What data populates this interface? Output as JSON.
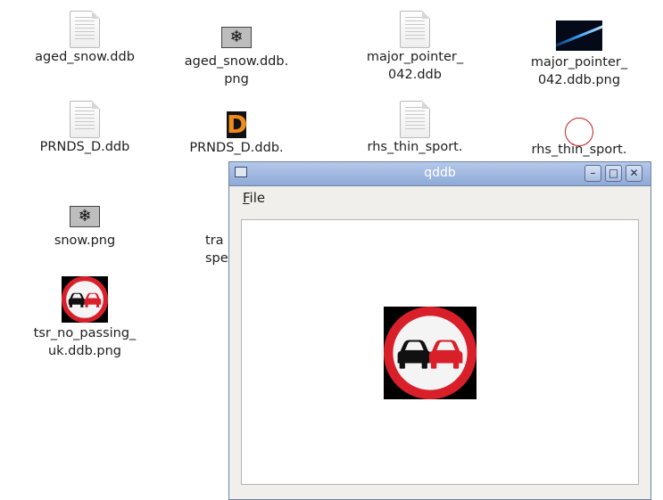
{
  "desktop": {
    "icons": [
      {
        "label": "aged_snow.ddb",
        "type": "document"
      },
      {
        "label": "aged_snow.ddb.\npng",
        "type": "snow-image"
      },
      {
        "label": "major_pointer_\n042.ddb",
        "type": "document"
      },
      {
        "label": "major_pointer_\n042.ddb.png",
        "type": "pointer-image"
      },
      {
        "label": "PRNDS_D.ddb",
        "type": "document"
      },
      {
        "label": "PRNDS_D.ddb.",
        "type": "d-image"
      },
      {
        "label": "rhs_thin_sport.",
        "type": "document"
      },
      {
        "label": "rhs_thin_sport.",
        "type": "ring-image"
      },
      {
        "label": "snow.png",
        "type": "snow-image"
      },
      {
        "label": "tra\nspe",
        "type": "partially-hidden"
      },
      {
        "label": "tsr_no_passing_\nuk.ddb.png",
        "type": "sign-image"
      }
    ]
  },
  "window": {
    "title": "qddb",
    "menu": {
      "file_mnemonic": "F",
      "file_rest": "ile"
    },
    "buttons": {
      "minimize": "–",
      "maximize": "□",
      "close": "✕"
    }
  },
  "colors": {
    "sign_red": "#d9202a",
    "titlebar": "#9fb7df",
    "window_bg": "#f1efeb"
  }
}
